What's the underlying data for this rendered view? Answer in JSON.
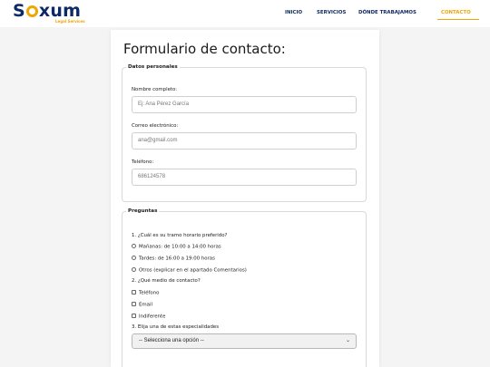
{
  "header": {
    "logo_text_left": "S",
    "logo_text_right": "xum",
    "logo_subtitle": "Legal Services",
    "nav": [
      {
        "label": "INICIO",
        "active": false
      },
      {
        "label": "SERVICIOS",
        "active": false
      },
      {
        "label": "DÓNDE TRABAJAMOS",
        "active": false
      },
      {
        "label": "CONTACTO",
        "active": true
      }
    ]
  },
  "form": {
    "title": "Formulario de contacto:",
    "personal": {
      "legend": "Datos personales",
      "name_label": "Nombre completo:",
      "name_placeholder": "Ej: Ana Pérez García",
      "email_label": "Correo electrónico:",
      "email_placeholder": "ana@gmail.com",
      "phone_label": "Teléfono:",
      "phone_placeholder": "686124578"
    },
    "questions": {
      "legend": "Preguntas",
      "q1": "1. ¿Cuál es su tramo horario preferido?",
      "q1_options": [
        "Mañanas: de 10:00 a 14:00 horas",
        "Tardes: de 16:00 a 19:00 horas",
        "Otros (explicar en el apartado Comentarios)"
      ],
      "q2": "2. ¿Qué medio de contacto?",
      "q2_options": [
        "Teléfono",
        "Email",
        "Indiferente"
      ],
      "q3": "3. Elija una de estas especialidades",
      "q3_select": "-- Selecciona una opción --"
    }
  },
  "colors": {
    "brand_navy": "#0d2a66",
    "accent_orange": "#f0a500"
  }
}
